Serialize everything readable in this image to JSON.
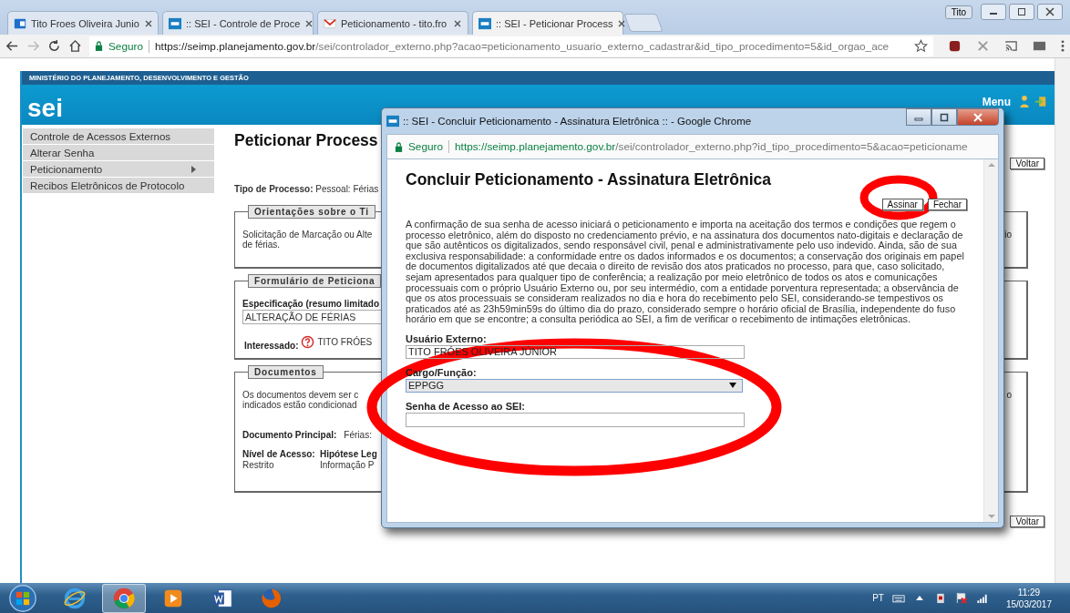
{
  "browser": {
    "tabs": [
      {
        "title": "Tito Froes Oliveira Junio",
        "selected": false
      },
      {
        "title": ":: SEI - Controle de Proce",
        "selected": false
      },
      {
        "title": "Peticionamento - tito.fro",
        "selected": false
      },
      {
        "title": ":: SEI - Peticionar Process",
        "selected": true
      }
    ],
    "profile": "Tito",
    "address": {
      "secure": "Seguro",
      "host": "https://seimp.planejamento.gov.br",
      "path": "/sei/controlador_externo.php?acao=peticionamento_usuario_externo_cadastrar&id_tipo_procedimento=5&id_orgao_ace"
    }
  },
  "header": {
    "ministry": "MINISTÉRIO DO PLANEJAMENTO, DESENVOLVIMENTO E GESTÃO",
    "logo": "sei",
    "menu": "Menu"
  },
  "sidebar": {
    "items": [
      {
        "label": "Controle de Acessos Externos",
        "submenu": false
      },
      {
        "label": "Alterar Senha",
        "submenu": false
      },
      {
        "label": "Peticionamento",
        "submenu": true
      },
      {
        "label": "Recibos Eletrônicos de Protocolo",
        "submenu": false
      }
    ]
  },
  "main": {
    "title": "Peticionar Process",
    "top_button": "Voltar",
    "bottom_button": "Voltar",
    "process_type": {
      "label": "Tipo de Processo:",
      "value": "Pessoal: Férias"
    },
    "guidance": {
      "legend": "Orientações sobre o Ti",
      "lines": [
        "Solicitação de Marcação ou Alte",
        "de férias."
      ],
      "edge_text": "io"
    },
    "form": {
      "legend": "Formulário de Peticiona",
      "spec_label": "Especificação (resumo limitado",
      "spec_value": "ALTERAÇÃO DE FÉRIAS",
      "interested_label": "Interessado:",
      "interested_value": "TITO FRÓES"
    },
    "documents": {
      "legend": "Documentos",
      "lines": [
        "Os documentos devem ser c",
        "indicados estão condicionad"
      ],
      "edge_text": "o",
      "main_label": "Documento Principal:",
      "main_value": "Férias:",
      "access_label": "Nível de Acesso:",
      "access_value": "Restrito",
      "hypothesis_label": "Hipótese Leg",
      "hypothesis_value": "Informação P"
    }
  },
  "popup": {
    "window_title": ":: SEI - Concluir Peticionamento - Assinatura Eletrônica :: - Google Chrome",
    "address": {
      "secure": "Seguro",
      "host": "https://seimp.planejamento.gov.br",
      "path": "/sei/controlador_externo.php?id_tipo_procedimento=5&acao=peticioname"
    },
    "heading": "Concluir Peticionamento - Assinatura Eletrônica",
    "buttons": [
      "Assinar",
      "Fechar"
    ],
    "notice": "A confirmação de sua senha de acesso iniciará o peticionamento e importa na aceitação dos termos e condições que regem o processo eletrônico, além do disposto no credenciamento prévio, e na assinatura dos documentos nato-digitais e declaração de que são autênticos os digitalizados, sendo responsável civil, penal e administrativamente pelo uso indevido. Ainda, são de sua exclusiva responsabilidade: a conformidade entre os dados informados e os documentos; a conservação dos originais em papel de documentos digitalizados até que decaia o direito de revisão dos atos praticados no processo, para que, caso solicitado, sejam apresentados para qualquer tipo de conferência; a realização por meio eletrônico de todos os atos e comunicações processuais com o próprio Usuário Externo ou, por seu intermédio, com a entidade porventura representada; a observância de que os atos processuais se consideram realizados no dia e hora do recebimento pelo SEI, considerando-se tempestivos os praticados até as 23h59min59s do último dia do prazo, considerado sempre o horário oficial de Brasília, independente do fuso horário em que se encontre; a consulta periódica ao SEI, a fim de verificar o recebimento de intimações eletrônicas.",
    "fields": [
      {
        "kind": "text",
        "label": "Usuário Externo:",
        "value": "TITO FRÓES OLIVEIRA JÚNIOR"
      },
      {
        "kind": "select",
        "label": "Cargo/Função:",
        "value": "EPPGG"
      },
      {
        "kind": "password",
        "label": "Senha de Acesso ao SEI:"
      }
    ]
  },
  "taskbar": {
    "apps": [
      {
        "selected": false
      },
      {
        "selected": true
      },
      {
        "selected": false
      },
      {
        "selected": false
      },
      {
        "selected": false
      }
    ],
    "language": "PT",
    "time": "11:29",
    "date": "15/03/2017"
  }
}
